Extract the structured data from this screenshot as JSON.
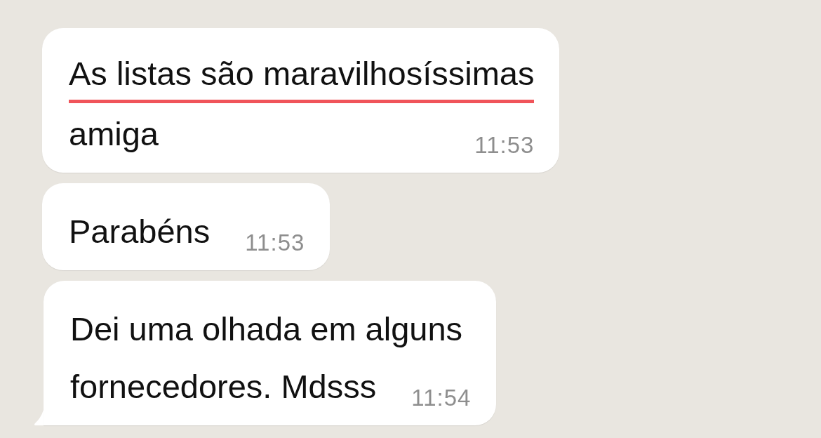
{
  "messages": [
    {
      "lines": [
        {
          "text": "As listas são maravilhosíssimas",
          "underlined": true
        },
        {
          "text": "amiga",
          "underlined": false
        }
      ],
      "time": "11:53",
      "tail": false
    },
    {
      "lines": [
        {
          "text": "Parabéns",
          "underlined": false
        }
      ],
      "time": "11:53",
      "tail": false
    },
    {
      "lines": [
        {
          "text": "Dei uma olhada em alguns",
          "underlined": false
        },
        {
          "text": "fornecedores. Mdsss",
          "underlined": false
        }
      ],
      "time": "11:54",
      "tail": true
    }
  ]
}
